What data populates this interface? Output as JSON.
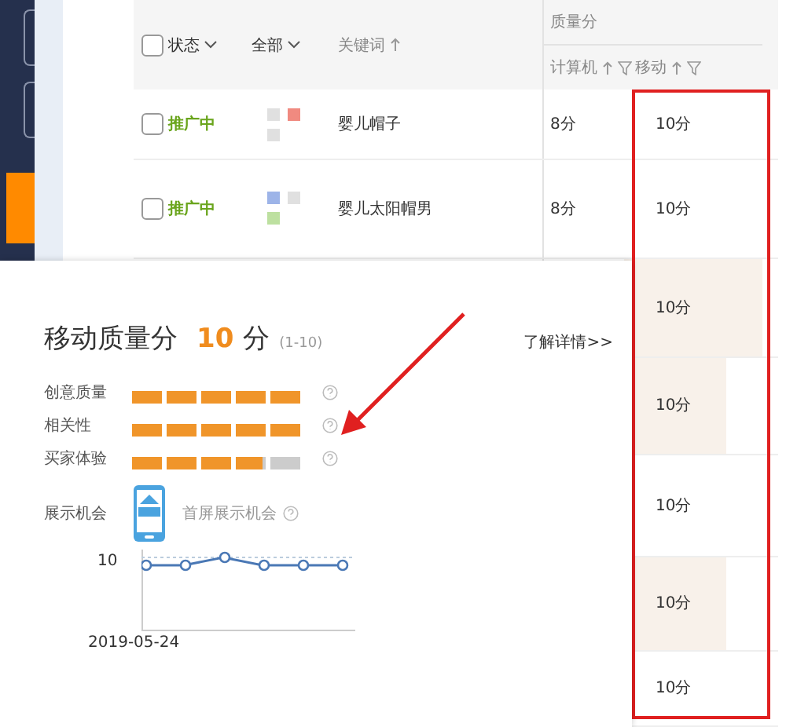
{
  "table": {
    "header": {
      "checkbox": {
        "checked": false
      },
      "status": "状态",
      "all": "全部",
      "keyword": "关键词",
      "quality_group": "质量分",
      "pc": "计算机",
      "mobile": "移动"
    },
    "rows": [
      {
        "checkbox": {
          "checked": false
        },
        "status": "推广中",
        "squares": [
          {
            "color": "#e0e0e0"
          },
          {
            "color": "#f08a80"
          },
          {
            "color": "#e0e0e0"
          }
        ],
        "keyword": "婴儿帽子",
        "pc": "8分",
        "mobile": "10分",
        "highlighted": false
      },
      {
        "checkbox": {
          "checked": false
        },
        "status": "推广中",
        "squares": [
          {
            "color": "#9db4e8"
          },
          {
            "color": "#e0e0e0"
          },
          {
            "color": "#bde0a0"
          }
        ],
        "keyword": "婴儿太阳帽男",
        "pc": "8分",
        "mobile": "10分",
        "highlighted": false
      },
      {
        "mobile": "10分",
        "highlighted": true,
        "wide": true
      },
      {
        "mobile": "10分",
        "highlighted": true,
        "wide": false
      },
      {
        "mobile": "10分",
        "highlighted": false
      },
      {
        "mobile": "10分",
        "highlighted": true,
        "wide": false
      },
      {
        "mobile": "10分",
        "highlighted": false
      }
    ]
  },
  "popup": {
    "title": "移动质量分",
    "score": "10",
    "unit": "分",
    "range": "(1-10)",
    "link": "了解详情>>",
    "metrics": [
      {
        "label": "创意质量",
        "level": 1
      },
      {
        "label": "相关性",
        "level": 1
      },
      {
        "label": "买家体验",
        "level": 0.8
      }
    ],
    "exposure": {
      "label": "展示机会",
      "value": "首屏展示机会"
    },
    "trend": {
      "y_tick": "10",
      "x_label": "2019-05-24"
    }
  }
}
